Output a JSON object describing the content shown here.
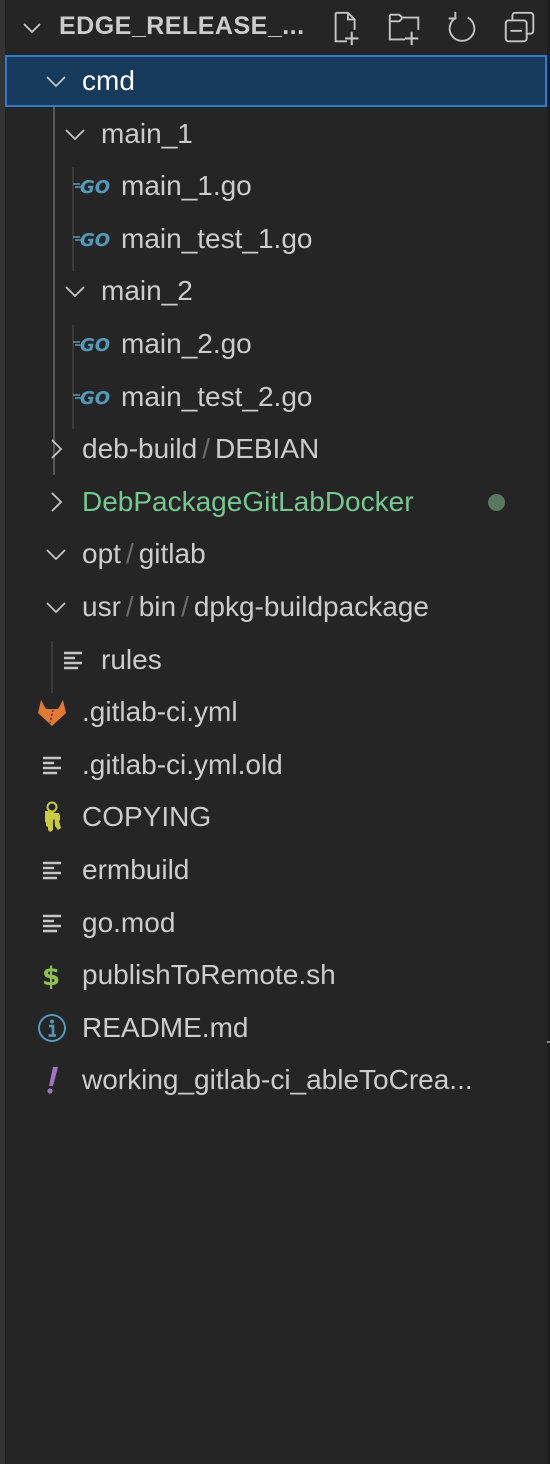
{
  "explorer": {
    "section_title": "EDGE_RELEASE_...",
    "section_expanded": true,
    "actions": [
      {
        "name": "new-file",
        "tooltip_icon": "new-file-icon"
      },
      {
        "name": "new-folder",
        "tooltip_icon": "new-folder-icon"
      },
      {
        "name": "refresh",
        "tooltip_icon": "refresh-icon"
      },
      {
        "name": "collapse-all",
        "tooltip_icon": "collapse-all-icon"
      }
    ]
  },
  "tree": [
    {
      "type": "folder",
      "depth": 0,
      "expanded": true,
      "selected": true,
      "segments": [
        "cmd"
      ]
    },
    {
      "type": "folder",
      "depth": 1,
      "expanded": true,
      "segments": [
        "main_1"
      ]
    },
    {
      "type": "file",
      "depth": 2,
      "icon": "go-icon",
      "label": "main_1.go"
    },
    {
      "type": "file",
      "depth": 2,
      "icon": "go-icon",
      "label": "main_test_1.go"
    },
    {
      "type": "folder",
      "depth": 1,
      "expanded": true,
      "segments": [
        "main_2"
      ]
    },
    {
      "type": "file",
      "depth": 2,
      "icon": "go-icon",
      "label": "main_2.go"
    },
    {
      "type": "file",
      "depth": 2,
      "icon": "go-icon",
      "label": "main_test_2.go"
    },
    {
      "type": "folder",
      "depth": 0,
      "expanded": false,
      "segments": [
        "deb-build",
        "DEBIAN"
      ]
    },
    {
      "type": "folder",
      "depth": 0,
      "expanded": false,
      "segments": [
        "DebPackageGitLabDocker"
      ],
      "git_status": "untracked",
      "decoration": "dot"
    },
    {
      "type": "folder",
      "depth": 0,
      "expanded": true,
      "segments": [
        "opt",
        "gitlab"
      ]
    },
    {
      "type": "folder",
      "depth": 0,
      "expanded": true,
      "segments": [
        "usr",
        "bin",
        "dpkg-buildpackage"
      ]
    },
    {
      "type": "file",
      "depth": 1,
      "icon": "text-file-icon",
      "label": "rules"
    },
    {
      "type": "file",
      "depth": 0,
      "icon": "gitlab-icon",
      "label": ".gitlab-ci.yml"
    },
    {
      "type": "file",
      "depth": 0,
      "icon": "text-file-icon",
      "label": ".gitlab-ci.yml.old"
    },
    {
      "type": "file",
      "depth": 0,
      "icon": "license-key-icon",
      "label": "COPYING"
    },
    {
      "type": "file",
      "depth": 0,
      "icon": "text-file-icon",
      "label": "ermbuild"
    },
    {
      "type": "file",
      "depth": 0,
      "icon": "text-file-icon",
      "label": "go.mod"
    },
    {
      "type": "file",
      "depth": 0,
      "icon": "shell-script-icon",
      "label": "publishToRemote.sh"
    },
    {
      "type": "file",
      "depth": 0,
      "icon": "info-icon",
      "label": "README.md"
    },
    {
      "type": "file",
      "depth": 0,
      "icon": "yaml-exclamation-icon",
      "label": "working_gitlab-ci_ableToCrea..."
    }
  ],
  "colors": {
    "background": "#252526",
    "selection_bg": "#163a5c",
    "selection_border": "#2f7bd1",
    "text": "#cccccc",
    "git_untracked": "#73c991",
    "go_icon": "#519aba",
    "gitlab_icon": "#e37933",
    "key_icon": "#cbcb41",
    "shell_icon": "#8dc149",
    "info_icon": "#519aba",
    "yaml_icon": "#a074c4"
  }
}
